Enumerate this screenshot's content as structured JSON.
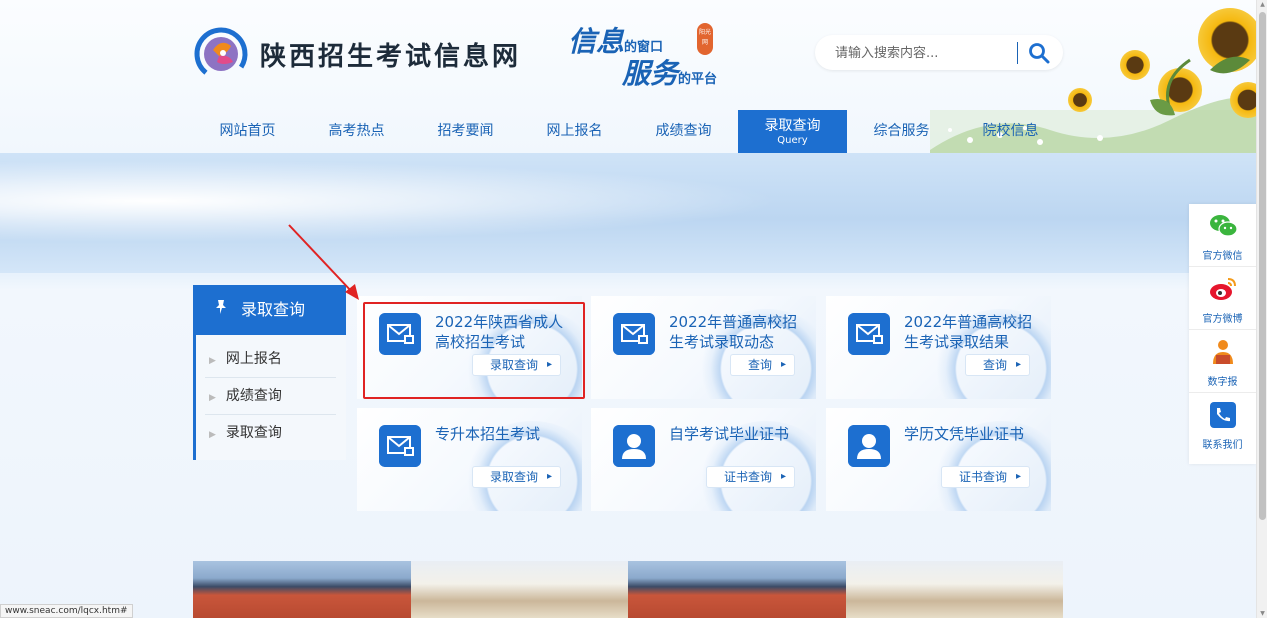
{
  "header": {
    "site_name": "陕西招生考试信息网",
    "slogan_line1_main": "信息",
    "slogan_line1_small": "的窗口",
    "slogan_line2_main": "服务",
    "slogan_line2_small": "的平台",
    "seal_text": "阳光网",
    "search_placeholder": "请输入搜索内容..."
  },
  "nav": {
    "items": [
      {
        "label": "网站首页"
      },
      {
        "label": "高考热点"
      },
      {
        "label": "招考要闻"
      },
      {
        "label": "网上报名"
      },
      {
        "label": "成绩查询"
      },
      {
        "label": "录取查询",
        "sub": "Query"
      },
      {
        "label": "综合服务"
      },
      {
        "label": "院校信息"
      }
    ]
  },
  "sidebar": {
    "title": "录取查询",
    "items": [
      {
        "label": "网上报名"
      },
      {
        "label": "成绩查询"
      },
      {
        "label": "录取查询"
      }
    ]
  },
  "cards": [
    {
      "title": "2022年陕西省成人高校招生考试",
      "button": "录取查询",
      "icon": "mail-icon"
    },
    {
      "title": "2022年普通高校招生考试录取动态",
      "button": "查询",
      "icon": "mail-icon"
    },
    {
      "title": "2022年普通高校招生考试录取结果",
      "button": "查询",
      "icon": "mail-icon"
    },
    {
      "title": "专升本招生考试",
      "button": "录取查询",
      "icon": "mail-icon"
    },
    {
      "title": "自学考试毕业证书",
      "button": "证书查询",
      "icon": "person-icon"
    },
    {
      "title": "学历文凭毕业证书",
      "button": "证书查询",
      "icon": "person-icon"
    }
  ],
  "float_bar": {
    "items": [
      {
        "label": "官方微信",
        "icon": "wechat-icon"
      },
      {
        "label": "官方微博",
        "icon": "weibo-icon"
      },
      {
        "label": "数字报",
        "icon": "reader-icon"
      },
      {
        "label": "联系我们",
        "icon": "phone-icon"
      }
    ]
  },
  "status_bar": {
    "url": "www.sneac.com/lqcx.htm#"
  },
  "colors": {
    "brand_blue": "#1d6fd0",
    "highlight_red": "#e02323"
  }
}
